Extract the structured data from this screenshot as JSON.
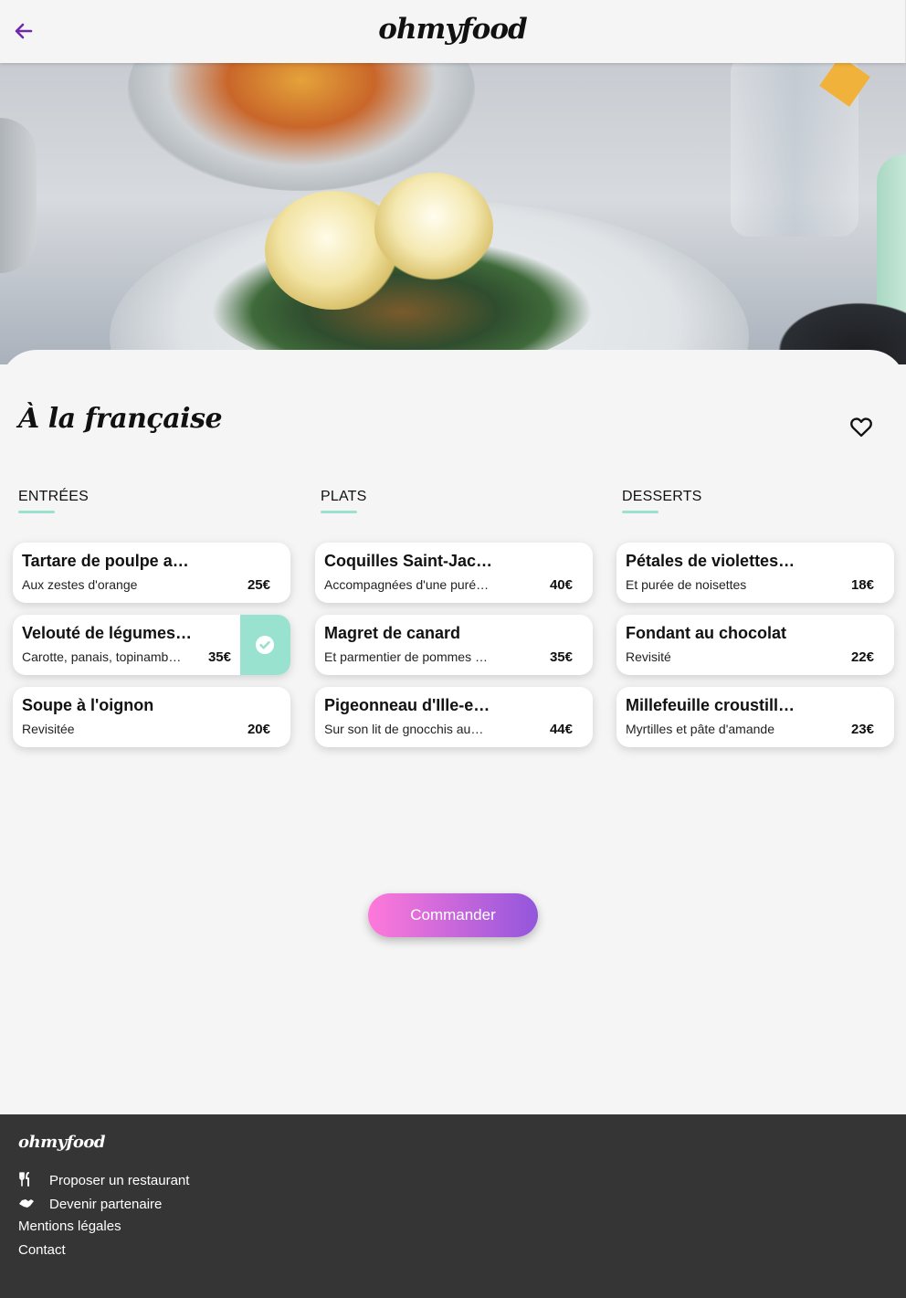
{
  "header": {
    "logo": "ohmyfood",
    "back_icon": "arrow-left-icon",
    "accent_color": "#6e2ba4"
  },
  "restaurant": {
    "name": "À la française",
    "favorite_icon": "heart-outline-icon"
  },
  "menu": {
    "columns": [
      {
        "title": "ENTRÉES",
        "items": [
          {
            "name": "Tartare de poulpe a…",
            "description": "Aux zestes d'orange",
            "price": "25€",
            "selected": false
          },
          {
            "name": "Velouté de légumes…",
            "description": "Carotte, panais, topinamb…",
            "price": "35€",
            "selected": true
          },
          {
            "name": "Soupe à l'oignon",
            "description": "Revisitée",
            "price": "20€",
            "selected": false
          }
        ]
      },
      {
        "title": "PLATS",
        "items": [
          {
            "name": "Coquilles Saint-Jac…",
            "description": "Accompagnées d'une puré…",
            "price": "40€",
            "selected": false
          },
          {
            "name": "Magret de canard",
            "description": "Et parmentier de pommes …",
            "price": "35€",
            "selected": false
          },
          {
            "name": "Pigeonneau d'Ille-e…",
            "description": "Sur son lit de gnocchis au…",
            "price": "44€",
            "selected": false
          }
        ]
      },
      {
        "title": "DESSERTS",
        "items": [
          {
            "name": "Pétales de violettes…",
            "description": "Et purée de noisettes",
            "price": "18€",
            "selected": false
          },
          {
            "name": "Fondant au chocolat",
            "description": "Revisité",
            "price": "22€",
            "selected": false
          },
          {
            "name": "Millefeuille croustill…",
            "description": "Myrtilles et pâte d'amande",
            "price": "23€",
            "selected": false
          }
        ]
      }
    ],
    "selected_color": "#99e2d0",
    "check_icon": "check-circle-icon"
  },
  "order_button": {
    "label": "Commander",
    "gradient_start": "#ff79da",
    "gradient_end": "#9356dc"
  },
  "footer": {
    "logo": "ohmyfood",
    "links": [
      {
        "label": "Proposer un restaurant",
        "icon": "utensils-icon"
      },
      {
        "label": "Devenir partenaire",
        "icon": "handshake-icon"
      },
      {
        "label": "Mentions légales",
        "icon": ""
      },
      {
        "label": "Contact",
        "icon": ""
      }
    ]
  }
}
